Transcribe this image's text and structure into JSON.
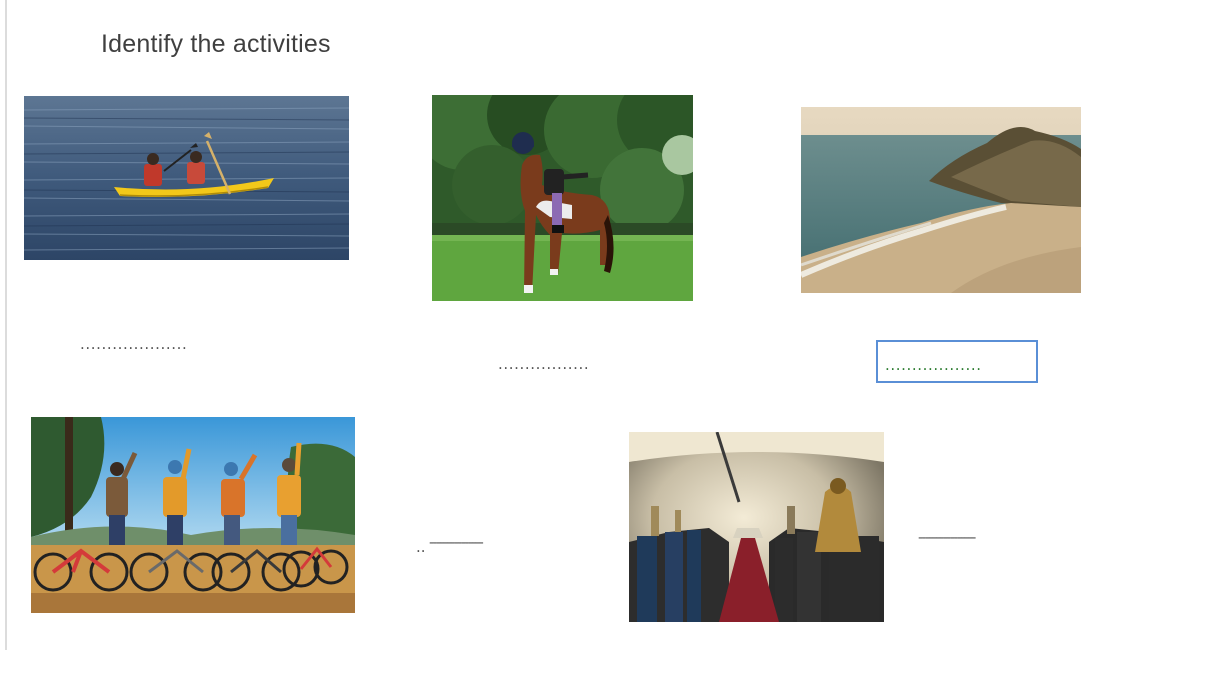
{
  "worksheet": {
    "title": "Identify the activities"
  },
  "answers": {
    "kayaking": "....................",
    "horse_riding": ".................",
    "beach": "..................",
    "cycling_prefix": "..",
    "cycling": "---------------",
    "museum": "----------------"
  },
  "colors": {
    "title_text": "#3f3f3f",
    "active_box_border": "#5a8fd6",
    "active_answer_text": "#2e7d32"
  }
}
